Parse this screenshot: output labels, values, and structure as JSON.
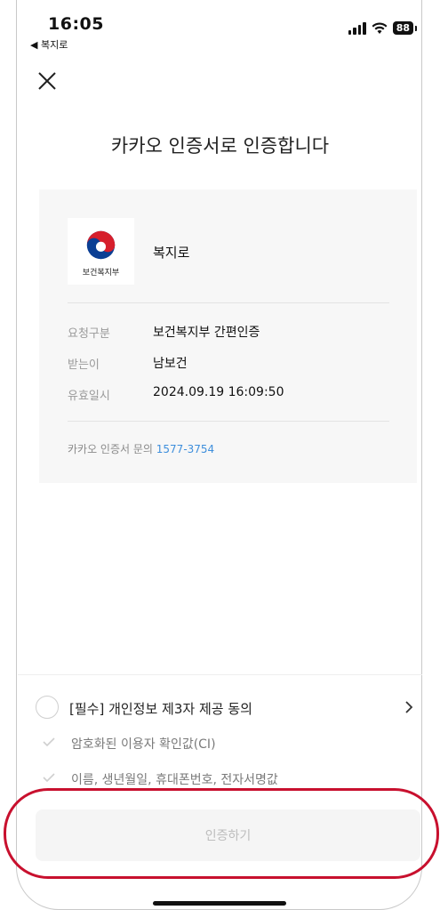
{
  "status_bar": {
    "time": "16:05",
    "back_app": "◀ 복지로",
    "battery": "88"
  },
  "header": {
    "title": "카카오 인증서로 인증합니다"
  },
  "card": {
    "logo_text": "보건복지부",
    "service_name": "복지로",
    "rows": [
      {
        "label": "요청구분",
        "value": "보건복지부 간편인증"
      },
      {
        "label": "받는이",
        "value": "남보건"
      },
      {
        "label": "유효일시",
        "value": "2024.09.19 16:09:50"
      }
    ],
    "inquiry_label": "카카오 인증서 문의",
    "inquiry_phone": "1577-3754"
  },
  "consent": {
    "main_label": "[필수] 개인정보 제3자 제공 동의",
    "sub_items": [
      "암호화된 이용자 확인값(CI)",
      "이름, 생년월일, 휴대폰번호, 전자서명값"
    ]
  },
  "cta": {
    "label": "인증하기"
  },
  "colors": {
    "accent_link": "#3f8fdc",
    "highlight": "#c8102e",
    "cta_disabled_bg": "#f5f5f5"
  }
}
